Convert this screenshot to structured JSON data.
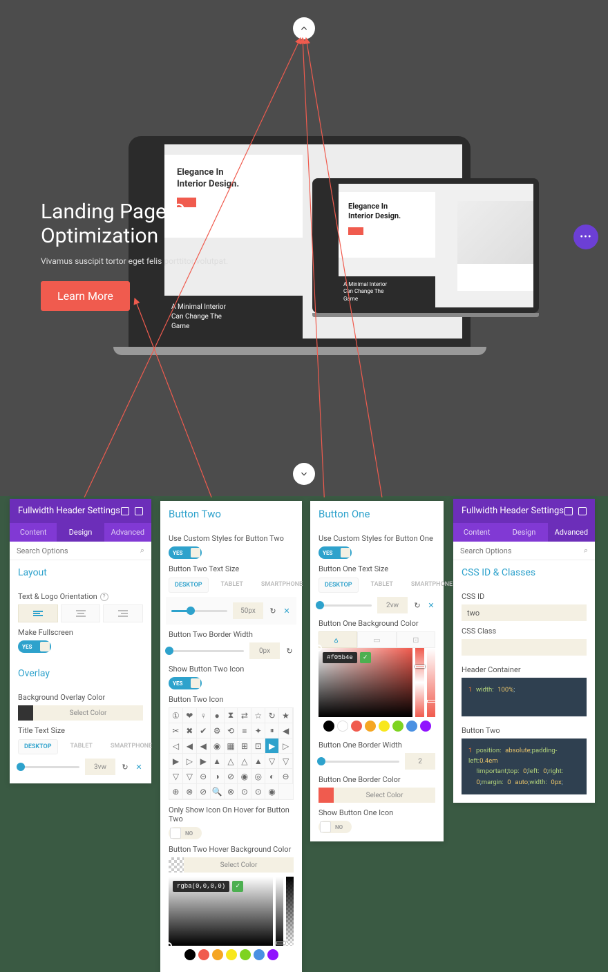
{
  "hero": {
    "title_line1": "Landing Page Conversion",
    "title_line2": "Optimization",
    "subtitle": "Vivamus suscipit tortor eget felis porttitor volutpat.",
    "cta_label": "Learn More",
    "mock_heading1": "Elegance In",
    "mock_heading2": "Interior Design.",
    "caption1": "A Minimal Interior",
    "caption2": "Can Change The",
    "caption3_cut": "Game",
    "fab_label": "•••"
  },
  "panel1": {
    "title": "Fullwidth Header Settings",
    "tabs": {
      "content": "Content",
      "design": "Design",
      "advanced": "Advanced",
      "active": "Design"
    },
    "search_placeholder": "Search Options",
    "section_layout": "Layout",
    "text_logo_orientation": "Text & Logo Orientation",
    "make_fullscreen": "Make Fullscreen",
    "make_fullscreen_toggle": "YES",
    "section_overlay": "Overlay",
    "bg_overlay_color": "Background Overlay Color",
    "select_color": "Select Color",
    "title_text_size": "Title Text Size",
    "devices": {
      "desktop": "DESKTOP",
      "tablet": "TABLET",
      "phone": "SMARTPHONE"
    },
    "title_size_value": "3vw"
  },
  "panel2": {
    "heading": "Button Two",
    "use_custom": "Use Custom Styles for Button Two",
    "use_custom_toggle": "YES",
    "text_size_label": "Button Two Text Size",
    "devices": {
      "desktop": "DESKTOP",
      "tablet": "TABLET",
      "phone": "SMARTPHONE"
    },
    "text_size_value": "50px",
    "border_width_label": "Button Two Border Width",
    "border_width_value": "0px",
    "show_icon_label": "Show Button Two Icon",
    "show_icon_toggle": "YES",
    "icon_label": "Button Two Icon",
    "only_hover_label": "Only Show Icon On Hover for Button Two",
    "only_hover_toggle": "NO",
    "hover_bg_label": "Button Two Hover Background Color",
    "select_color": "Select Color",
    "hover_bg_value": "rgba(0,0,0,0)"
  },
  "panel3": {
    "heading": "Button One",
    "use_custom": "Use Custom Styles for Button One",
    "use_custom_toggle": "YES",
    "text_size_label": "Button One Text Size",
    "devices": {
      "desktop": "DESKTOP",
      "tablet": "TABLET",
      "phone": "SMARTPHONE"
    },
    "text_size_value": "2vw",
    "bg_color_label": "Button One Background Color",
    "bg_color_value": "#f05b4e",
    "border_width_label": "Button One Border Width",
    "border_width_value": "2",
    "border_color_label": "Button One Border Color",
    "select_color": "Select Color",
    "show_icon_label": "Show Button One Icon",
    "show_icon_toggle": "NO"
  },
  "panel4": {
    "title": "Fullwidth Header Settings",
    "tabs": {
      "content": "Content",
      "design": "Design",
      "advanced": "Advanced",
      "active": "Advanced"
    },
    "search_placeholder": "Search Options",
    "section_css": "CSS ID & Classes",
    "css_id_label": "CSS ID",
    "css_id_value": "two",
    "css_class_label": "CSS Class",
    "css_class_value": "",
    "header_container_label": "Header Container",
    "header_container_code": "1 width: 100%;",
    "button_two_label": "Button Two",
    "code_ln1_num": "1",
    "code_ln1_p1": "position:",
    "code_ln1_v1": "absolute",
    "code_ln1_p2": "padding-left:",
    "code_ln1_v2": "0.4em",
    "code_ln2_p1": "!important;",
    "code_ln2_p2": "top:",
    "code_ln2_v2": "0",
    "code_ln2_p3": "left:",
    "code_ln2_v3": "0",
    "code_ln2_p4": "right:",
    "code_ln3_v1": "0",
    "code_ln3_p2": "margin:",
    "code_ln3_v2": "0",
    "code_ln3_v3": "auto",
    "code_ln3_p4": "width:",
    "code_ln3_v4": "0px"
  },
  "icons": [
    "①",
    "❤",
    "♀",
    "●",
    "⧗",
    "⇄",
    "☆",
    "↻",
    "★",
    "✂",
    "✖",
    "✔",
    "⚙",
    "⟲",
    "≡",
    "✦",
    "⏸",
    "◀",
    "◁",
    "◀",
    "◀",
    "◉",
    "▦",
    "⊞",
    "⊡",
    "▶",
    "▷",
    "▶",
    "▷",
    "▶",
    "▲",
    "△",
    "△",
    "▲",
    "▽",
    "▽",
    "▽",
    "▽",
    "⊝",
    "◑",
    "⊘",
    "◉",
    "◎",
    "◐",
    "⊖",
    "⊕",
    "⊗",
    "⊘",
    "🔍",
    "⊗",
    "⊙",
    "⊙",
    "◉"
  ],
  "selected_icon_index": 25,
  "swatch_colors": [
    "#000",
    "#fff",
    "#f05b4e",
    "#f5a623",
    "#f8e71c",
    "#7ed321",
    "#4a90e2",
    "#9013fe"
  ],
  "bw_swatches": [
    "#000",
    "#f05b4e",
    "#f5a623",
    "#f8e71c",
    "#7ed321",
    "#4a90e2",
    "#9013fe"
  ]
}
